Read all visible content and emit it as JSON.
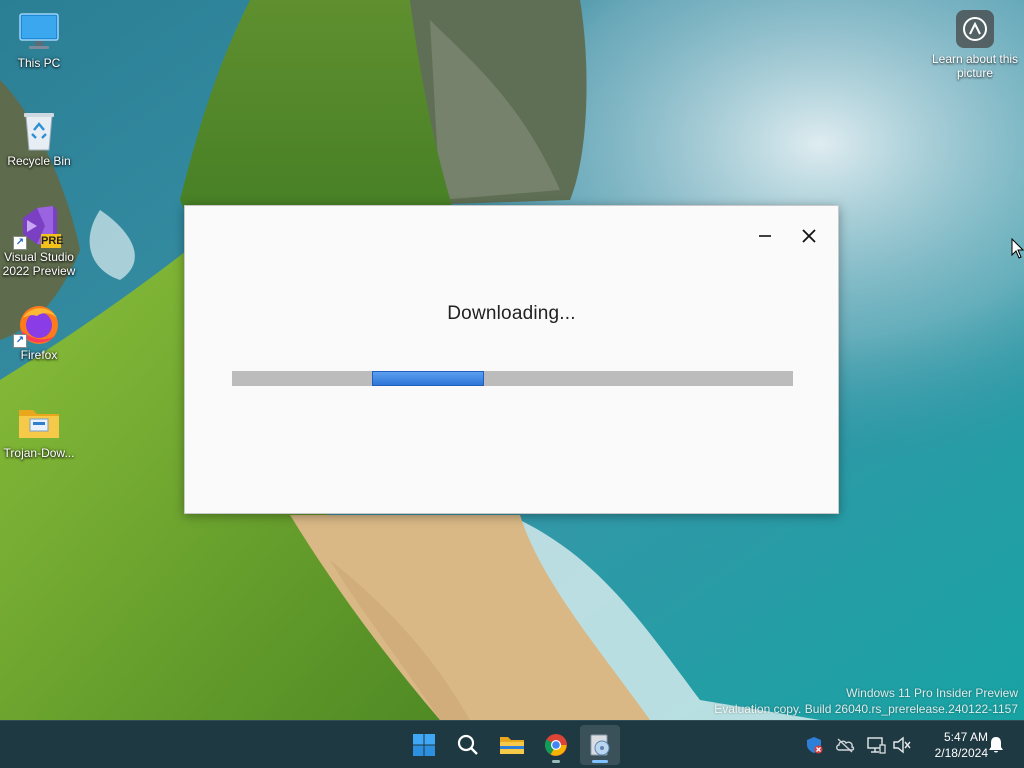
{
  "desktop": {
    "icons": [
      {
        "label": "This PC"
      },
      {
        "label": "Recycle Bin"
      },
      {
        "label": "Visual Studio 2022 Preview",
        "badge": "PRE"
      },
      {
        "label": "Firefox"
      },
      {
        "label": "Trojan-Dow..."
      }
    ],
    "learn_label": "Learn about this picture",
    "watermark": {
      "line1": "Windows 11 Pro Insider Preview",
      "line2": "Evaluation copy. Build 26040.rs_prerelease.240122-1157"
    }
  },
  "dialog": {
    "title": "Downloading...",
    "progress": {
      "state": "indeterminate",
      "fill_fraction": 0.2
    },
    "colors": {
      "track": "#bcbcbc",
      "fill": "#2d74d6"
    }
  },
  "taskbar": {
    "items": [
      "start-button",
      "search-button",
      "file-explorer",
      "chrome",
      "downloader-app"
    ],
    "active": "downloader-app",
    "clock": {
      "time": "5:47 AM",
      "date": "2/18/2024"
    }
  }
}
